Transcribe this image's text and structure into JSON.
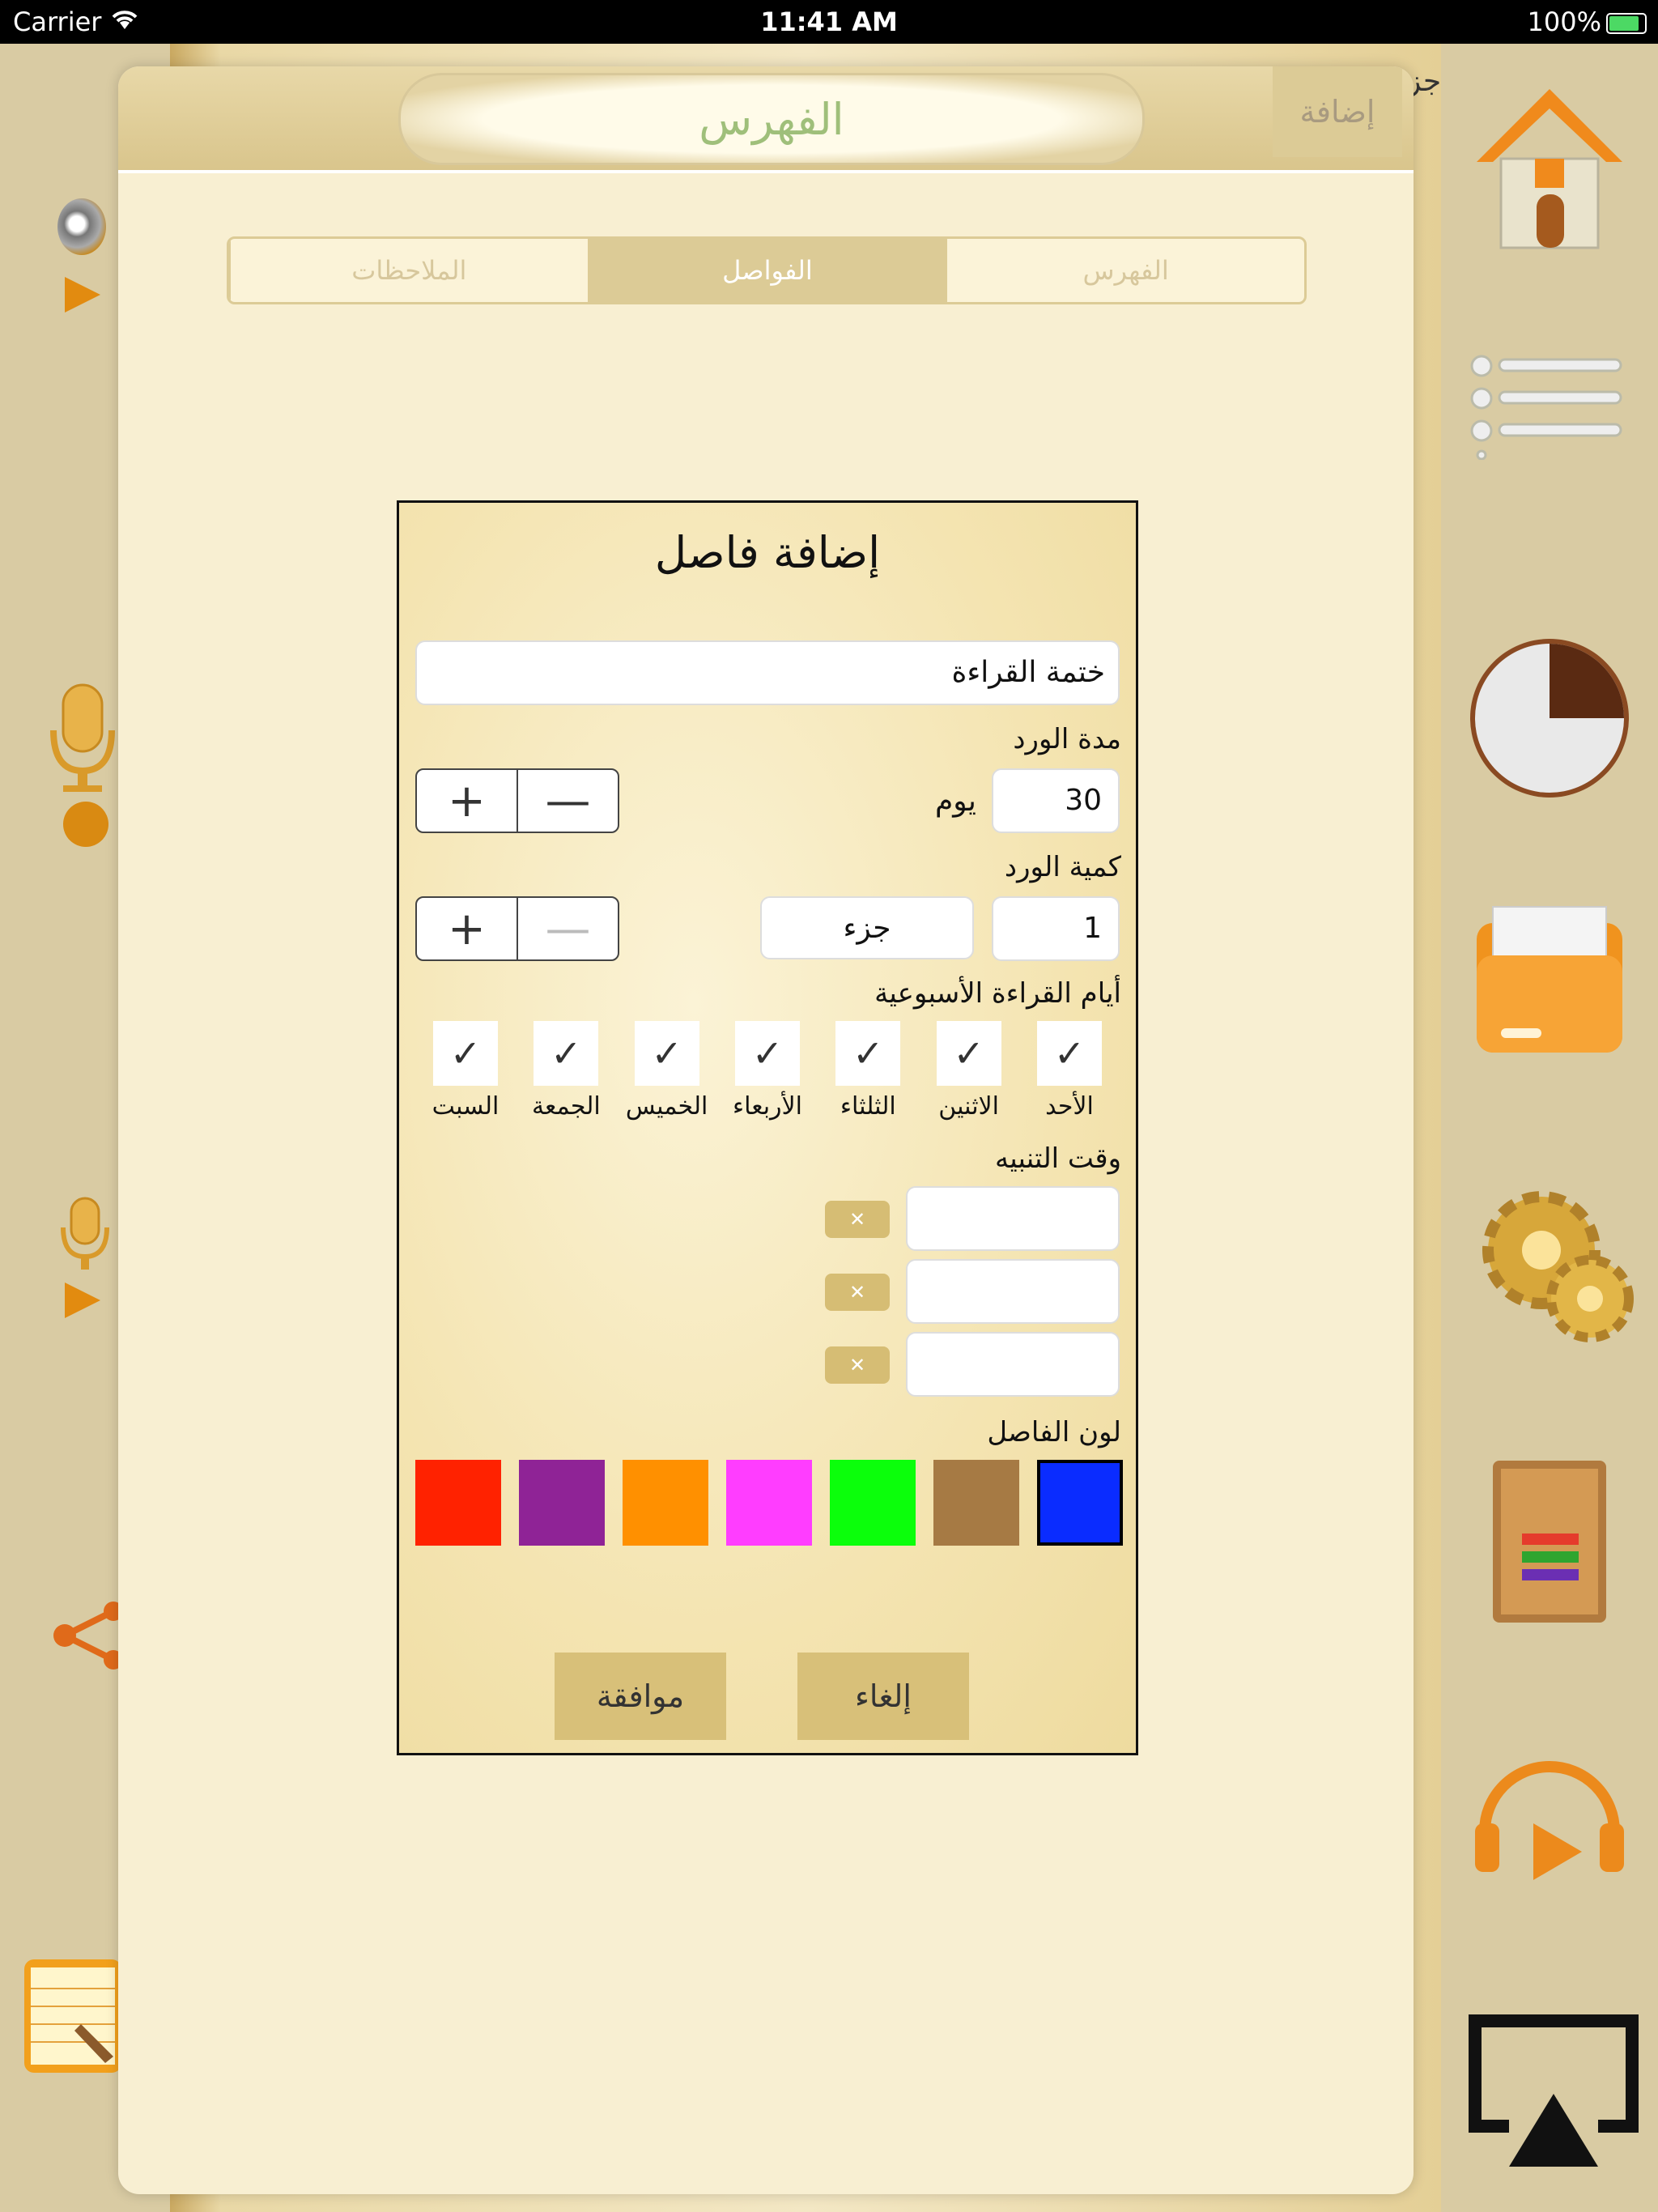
{
  "status_bar": {
    "carrier": "Carrier",
    "time": "11:41 AM",
    "battery": "100%"
  },
  "background": {
    "page_word": "جز"
  },
  "panel": {
    "title": "الفهرس",
    "add_button": "إضافة",
    "tabs": [
      {
        "label": "الفهرس",
        "active": false
      },
      {
        "label": "الفواصل",
        "active": true
      },
      {
        "label": "الملاحظات",
        "active": false
      }
    ]
  },
  "dialog": {
    "title": "إضافة فاصل",
    "name_value": "ختمة القراءة",
    "duration": {
      "label": "مدة الورد",
      "value": "30",
      "unit": "يوم"
    },
    "amount": {
      "label": "كمية الورد",
      "value": "1",
      "unit": "جزء"
    },
    "stepper": {
      "plus": "+",
      "minus": "—"
    },
    "weekdays_label": "أيام القراءة الأسبوعية",
    "weekdays": [
      {
        "label": "الأحد",
        "checked": true
      },
      {
        "label": "الاثنين",
        "checked": true
      },
      {
        "label": "الثلثاء",
        "checked": true
      },
      {
        "label": "الأربعاء",
        "checked": true
      },
      {
        "label": "الخميس",
        "checked": true
      },
      {
        "label": "الجمعة",
        "checked": true
      },
      {
        "label": "السبت",
        "checked": true
      }
    ],
    "alert_label": "وقت التنبيه",
    "alerts": [
      "",
      "",
      ""
    ],
    "color_label": "لون الفاصل",
    "colors": [
      "#0a2cff",
      "#a67a44",
      "#0bff0b",
      "#ff3dff",
      "#ff9000",
      "#8f2396",
      "#ff2200"
    ],
    "selected_color": "#0a2cff",
    "cancel": "إلغاء",
    "ok": "موافقة"
  }
}
